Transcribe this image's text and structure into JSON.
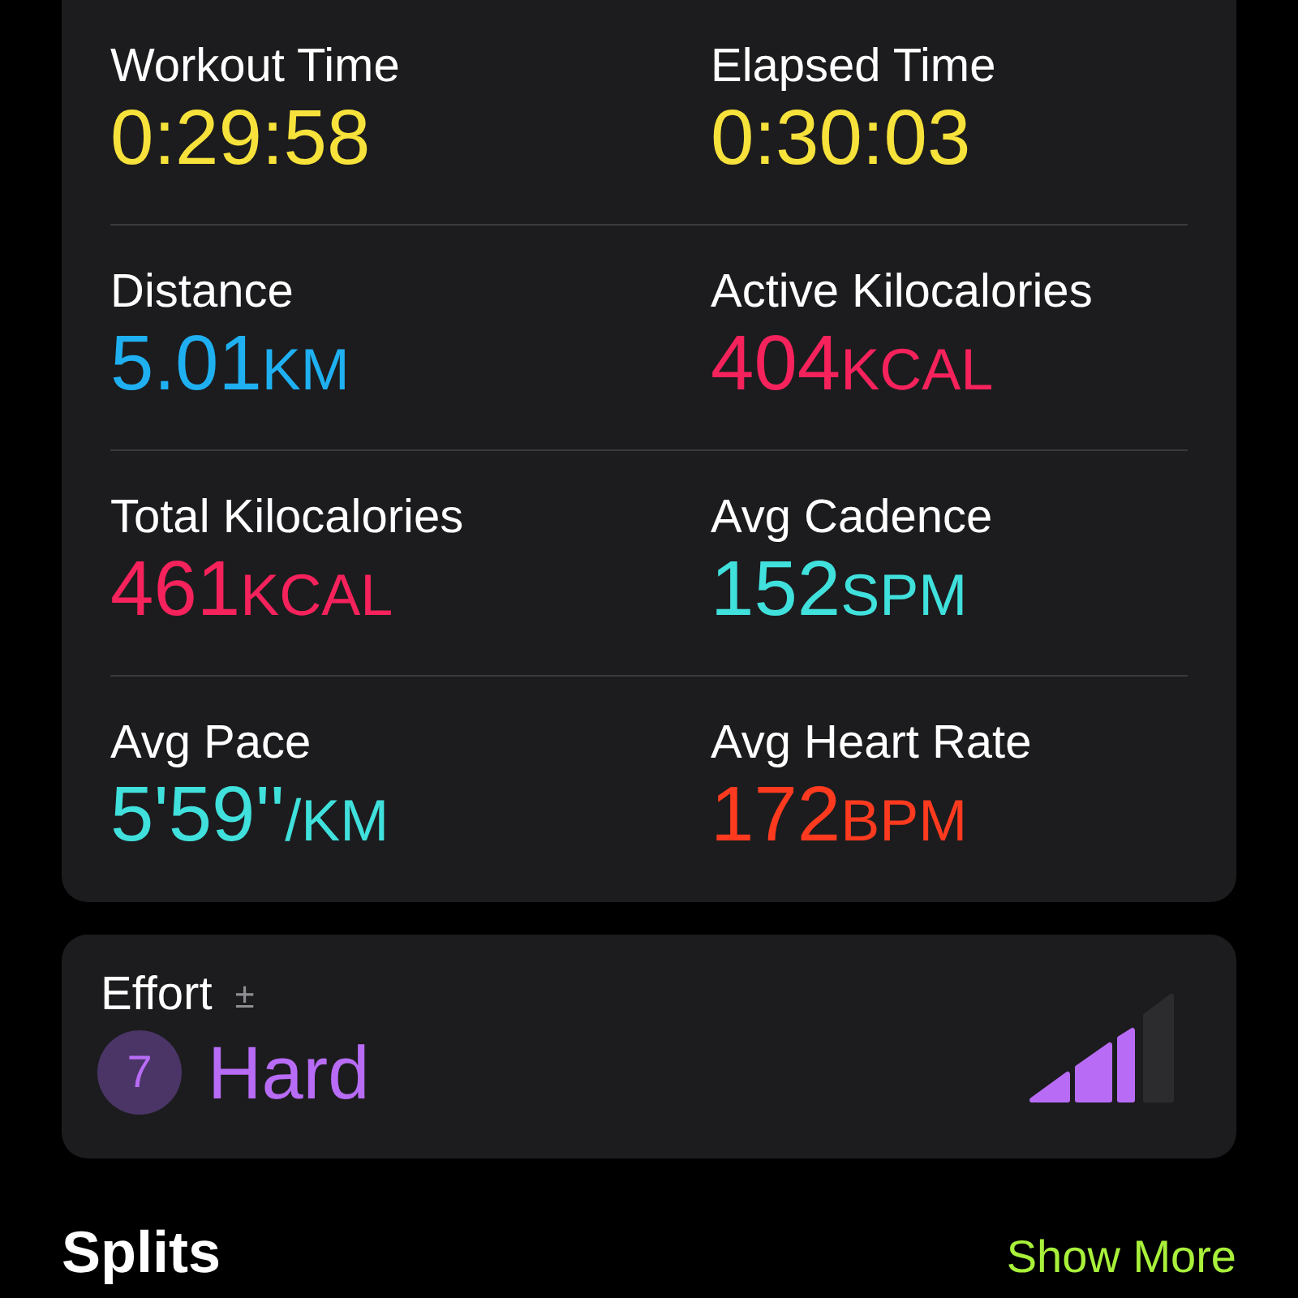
{
  "metrics": [
    {
      "label": "Workout Time",
      "value": "0:29:58",
      "color": "#f7e23b"
    },
    {
      "label": "Elapsed Time",
      "value": "0:30:03",
      "color": "#f7e23b"
    },
    {
      "label": "Distance",
      "value": "5.01",
      "unit": "KM",
      "color": "#1fb0f2"
    },
    {
      "label": "Active Kilocalories",
      "value": "404",
      "unit": "KCAL",
      "color": "#f6225c"
    },
    {
      "label": "Total Kilocalories",
      "value": "461",
      "unit": "KCAL",
      "color": "#f6225c"
    },
    {
      "label": "Avg Cadence",
      "value": "152",
      "unit": "SPM",
      "color": "#40e0dc"
    },
    {
      "label": "Avg Pace",
      "value": "5'59''",
      "unit": "/KM",
      "color": "#40e0dc"
    },
    {
      "label": "Avg Heart Rate",
      "value": "172",
      "unit": "BPM",
      "color": "#ff3a1f"
    }
  ],
  "effort": {
    "label": "Effort",
    "adjust": "±",
    "score": "7",
    "rating": "Hard",
    "level": 0.75
  },
  "splits": {
    "title": "Splits",
    "action": "Show More"
  }
}
